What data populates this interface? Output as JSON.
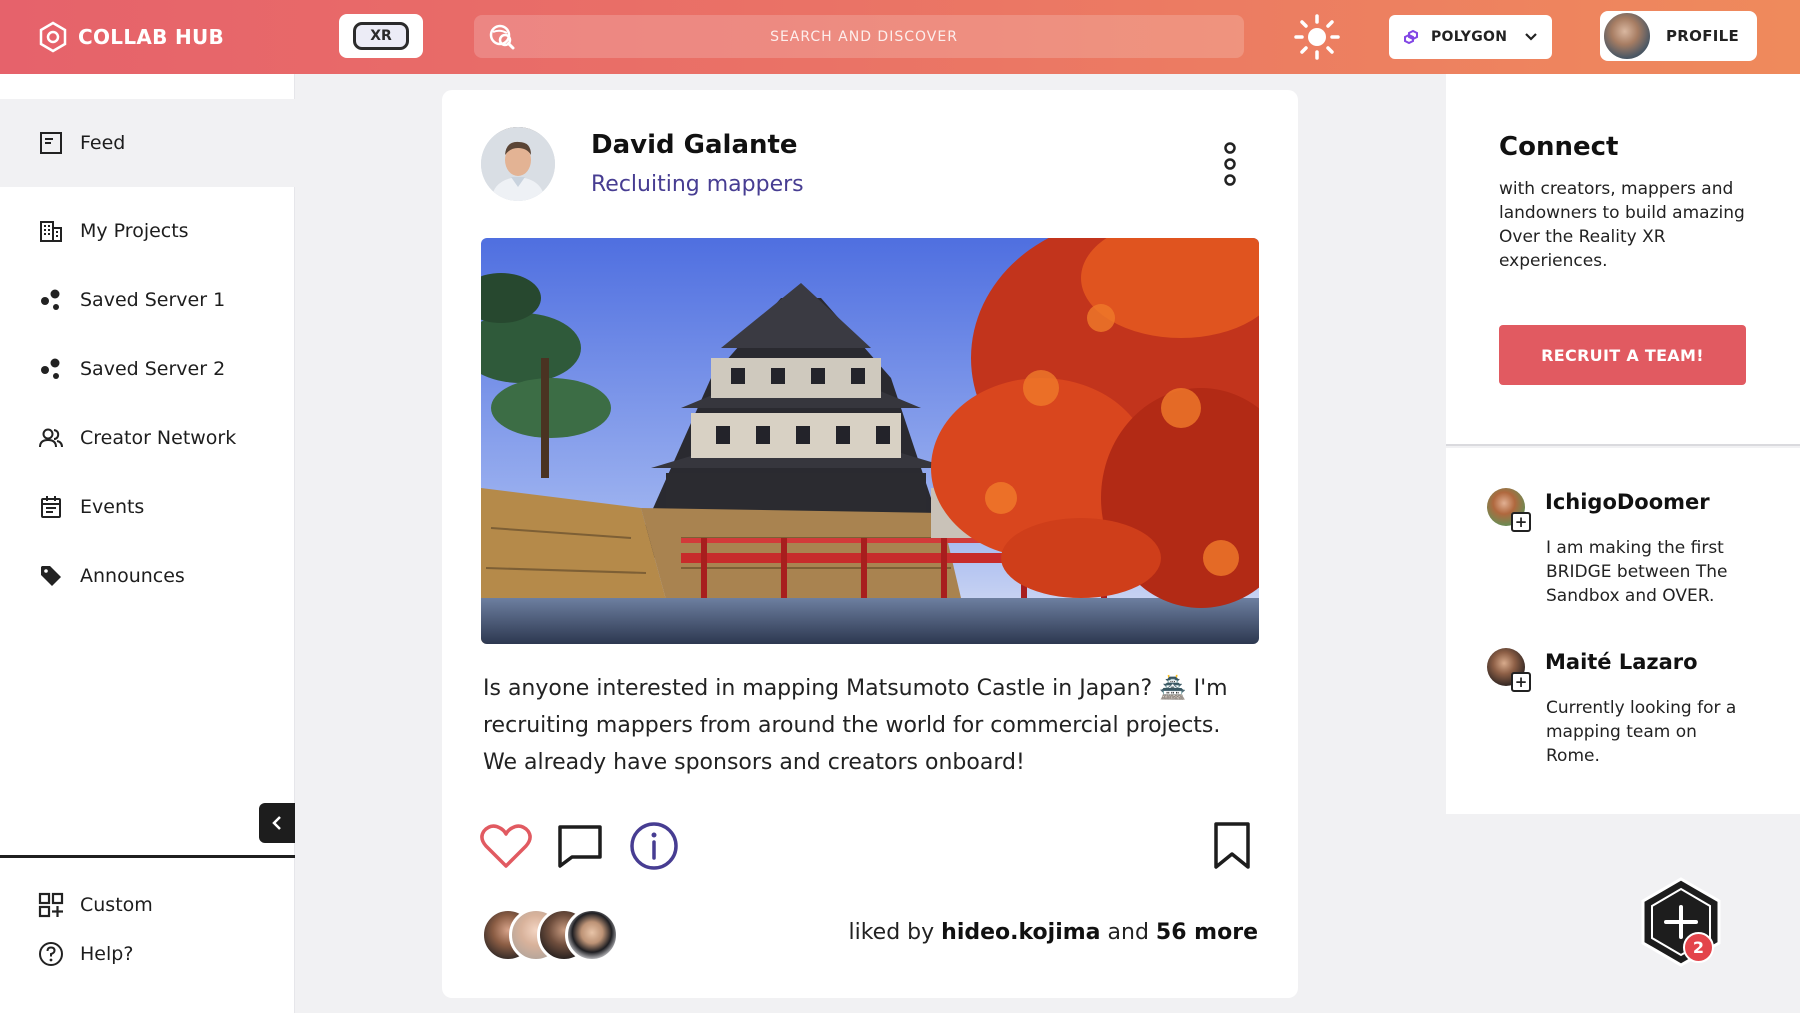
{
  "app": {
    "brand": "COLLAB HUB",
    "xr_label": "XR"
  },
  "search": {
    "placeholder": "SEARCH AND DISCOVER"
  },
  "network": {
    "selected": "POLYGON"
  },
  "profile": {
    "label": "PROFILE"
  },
  "sidebar": {
    "items": [
      {
        "label": "Feed",
        "icon": "feed-icon",
        "active": true
      },
      {
        "label": "My Projects",
        "icon": "building-icon"
      },
      {
        "label": "Saved Server 1",
        "icon": "server-nodes-icon"
      },
      {
        "label": "Saved Server 2",
        "icon": "server-nodes-icon"
      },
      {
        "label": "Creator Network",
        "icon": "people-icon"
      },
      {
        "label": "Events",
        "icon": "calendar-icon"
      },
      {
        "label": "Announces",
        "icon": "tag-icon"
      }
    ],
    "bottom_items": [
      {
        "label": "Custom",
        "icon": "grid-plus-icon"
      },
      {
        "label": "Help?",
        "icon": "question-circle-icon"
      }
    ]
  },
  "post": {
    "author": "David Galante",
    "subtitle": "Recluiting mappers",
    "text": "Is anyone interested in mapping Matsumoto Castle in Japan? 🏯 I'm recruiting mappers from around the world for commercial projects. We already have sponsors and creators onboard!",
    "liked_prefix": "liked by",
    "liked_user": "hideo.kojima",
    "liked_and": "and",
    "liked_more": "56 more",
    "image_subject": "Matsumoto Castle with red maple leaves and red bridge"
  },
  "connect": {
    "title": "Connect",
    "description": "with creators, mappers and landowners to build amazing Over the Reality XR experiences.",
    "button": "RECRUIT A TEAM!"
  },
  "suggestions": [
    {
      "name": "IchigoDoomer",
      "description": "I am making the first BRIDGE between The Sandbox and OVER."
    },
    {
      "name": "Maité Lazaro",
      "description": "Currently looking for a mapping team on Rome."
    }
  ],
  "fab": {
    "badge": "2"
  },
  "colors": {
    "accent": "#e15a61",
    "subtitle": "#473d92",
    "topbar_start": "#e6626b",
    "topbar_end": "#ef8a5c"
  }
}
